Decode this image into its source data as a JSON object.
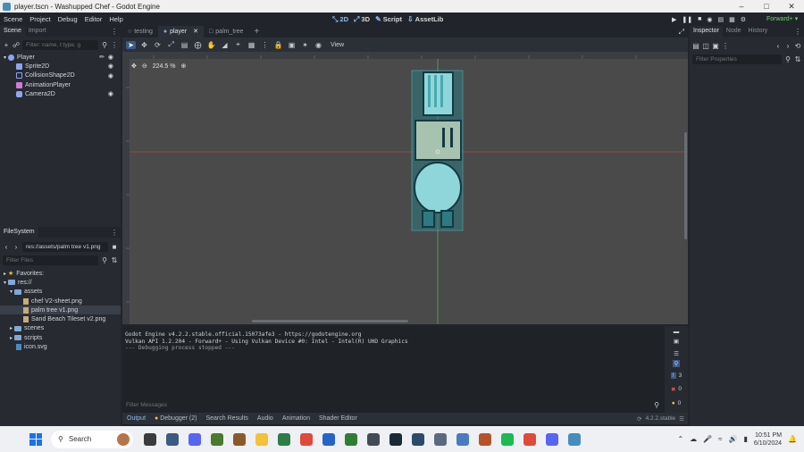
{
  "window": {
    "title": "player.tscn - Washupped Chef - Godot Engine"
  },
  "menubar": {
    "items": [
      "Scene",
      "Project",
      "Debug",
      "Editor",
      "Help"
    ]
  },
  "main_tabs": [
    {
      "label": "2D",
      "icon": "2d-icon",
      "active": true
    },
    {
      "label": "3D",
      "icon": "3d-icon",
      "active": false
    },
    {
      "label": "Script",
      "icon": "script-icon",
      "active": false
    },
    {
      "label": "AssetLib",
      "icon": "assetlib-icon",
      "active": false
    }
  ],
  "renderer": {
    "label": "Forward+"
  },
  "scene_dock": {
    "tabs": [
      "Scene",
      "Import"
    ],
    "filter_placeholder": "Filter: name, t:type, g",
    "nodes": [
      {
        "name": "Player",
        "icon": "characterbody2d-icon",
        "color": "#8da5f3",
        "indent": 0,
        "visible": true
      },
      {
        "name": "Sprite2D",
        "icon": "sprite2d-icon",
        "color": "#8da5f3",
        "indent": 1,
        "visible": true
      },
      {
        "name": "CollisionShape2D",
        "icon": "collisionshape2d-icon",
        "color": "#8da5f3",
        "indent": 1,
        "visible": true
      },
      {
        "name": "AnimationPlayer",
        "icon": "animationplayer-icon",
        "color": "#d07ad9",
        "indent": 1,
        "visible": false
      },
      {
        "name": "Camera2D",
        "icon": "camera2d-icon",
        "color": "#8da5f3",
        "indent": 1,
        "visible": true
      }
    ]
  },
  "filesystem": {
    "title": "FileSystem",
    "path": "res://assets/palm tree v1.png",
    "filter_placeholder": "Filter Files",
    "items": [
      {
        "label": "Favorites:",
        "type": "favorites",
        "indent": 0
      },
      {
        "label": "res://",
        "type": "folder",
        "indent": 0
      },
      {
        "label": "assets",
        "type": "folder",
        "indent": 1
      },
      {
        "label": "chef V2-sheet.png",
        "type": "file",
        "indent": 2
      },
      {
        "label": "palm tree v1.png",
        "type": "file",
        "indent": 2,
        "selected": true
      },
      {
        "label": "Sand Beach Tileset v2.png",
        "type": "file",
        "indent": 2
      },
      {
        "label": "scenes",
        "type": "folder",
        "indent": 1
      },
      {
        "label": "scripts",
        "type": "folder",
        "indent": 1
      },
      {
        "label": "icon.svg",
        "type": "file",
        "indent": 1
      }
    ]
  },
  "scene_tabs": [
    {
      "label": "testing",
      "active": false
    },
    {
      "label": "player",
      "active": true
    },
    {
      "label": "palm_tree",
      "active": false
    }
  ],
  "viewport": {
    "zoom": "224.5 %",
    "view_menu": "View"
  },
  "inspector": {
    "tabs": [
      "Inspector",
      "Node",
      "History"
    ],
    "filter_placeholder": "Filter Properties"
  },
  "output": {
    "lines": [
      "Godot Engine v4.2.2.stable.official.15073afe3 - https://godotengine.org",
      "Vulkan API 1.2.204 - Forward+ - Using Vulkan Device #0: Intel - Intel(R) UHD Graphics",
      "",
      "--- Debugging process stopped ---"
    ],
    "filter_placeholder": "Filter Messages",
    "counters": {
      "messages": "3",
      "errors": "0",
      "warnings": "0",
      "info": "1"
    }
  },
  "bottom_tabs": [
    {
      "label": "Output",
      "active": true
    },
    {
      "label": "Debugger (2)",
      "active": false
    },
    {
      "label": "Search Results",
      "active": false
    },
    {
      "label": "Audio",
      "active": false
    },
    {
      "label": "Animation",
      "active": false
    },
    {
      "label": "Shader Editor",
      "active": false
    }
  ],
  "version": "4.2.2.stable",
  "taskbar": {
    "search_label": "Search",
    "time": "10:51 PM",
    "date": "6/10/2024",
    "apps": [
      {
        "name": "task-view-icon",
        "color": "#3b3b3b"
      },
      {
        "name": "terminal-icon",
        "color": "#3d5a80"
      },
      {
        "name": "discord-bot-icon",
        "color": "#5865f2"
      },
      {
        "name": "minecraft-icon",
        "color": "#4a7a2c"
      },
      {
        "name": "game-icon",
        "color": "#8b5a2b"
      },
      {
        "name": "file-explorer-icon",
        "color": "#f3c13a"
      },
      {
        "name": "apps-icon",
        "color": "#2d7d46"
      },
      {
        "name": "chrome-icon",
        "color": "#e04a3a"
      },
      {
        "name": "store-icon",
        "color": "#2563c9"
      },
      {
        "name": "xbox-icon",
        "color": "#2e7d32"
      },
      {
        "name": "monitor-icon",
        "color": "#444b55"
      },
      {
        "name": "steam-icon",
        "color": "#1b2838"
      },
      {
        "name": "ship-icon",
        "color": "#2e4a6b"
      },
      {
        "name": "settings-icon",
        "color": "#5a6b80"
      },
      {
        "name": "paint-icon",
        "color": "#4a7abf"
      },
      {
        "name": "game2-icon",
        "color": "#b5542b"
      },
      {
        "name": "spotify-icon",
        "color": "#1db954"
      },
      {
        "name": "chrome2-icon",
        "color": "#e04a3a"
      },
      {
        "name": "discord-icon",
        "color": "#5865f2"
      },
      {
        "name": "godot-icon",
        "color": "#478cbf"
      }
    ]
  }
}
